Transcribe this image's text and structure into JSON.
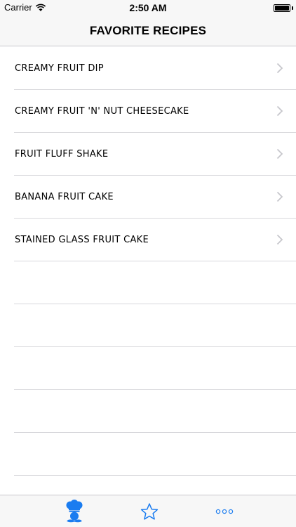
{
  "status_bar": {
    "carrier": "Carrier",
    "time": "2:50 AM",
    "icons": [
      "wifi-icon",
      "battery-icon"
    ]
  },
  "nav": {
    "title": "FAVORITE RECIPES"
  },
  "recipes": [
    {
      "label": "CREAMY FRUIT DIP"
    },
    {
      "label": "CREAMY FRUIT 'N' NUT CHEESECAKE"
    },
    {
      "label": "FRUIT FLUFF SHAKE"
    },
    {
      "label": "BANANA FRUIT CAKE"
    },
    {
      "label": "STAINED GLASS FRUIT CAKE"
    }
  ],
  "tab_bar": {
    "tabs": [
      {
        "icon": "chef-icon",
        "selected": true
      },
      {
        "icon": "star-icon",
        "selected": false
      },
      {
        "icon": "more-icon",
        "selected": false
      }
    ],
    "accent_color": "#1a7cf0"
  }
}
